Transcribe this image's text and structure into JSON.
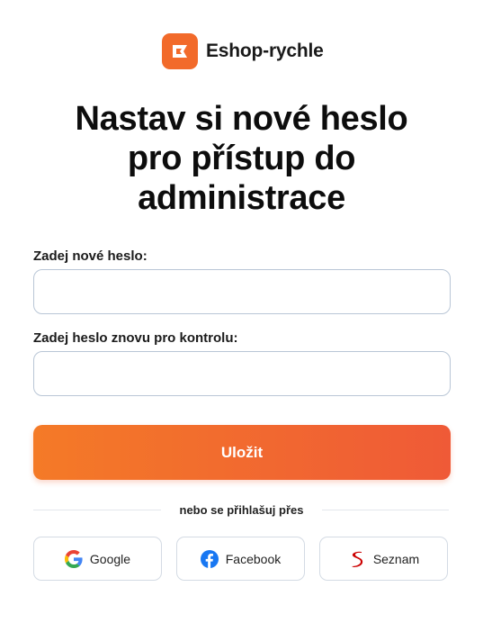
{
  "brand": {
    "name": "Eshop-rychle",
    "icon": "rocket-ticket-icon",
    "color": "#f26a2a"
  },
  "title": {
    "line1": "Nastav si nové heslo",
    "line2": "pro přístup do",
    "line3": "administrace"
  },
  "form": {
    "new_password_label": "Zadej nové heslo:",
    "new_password_value": "",
    "confirm_password_label": "Zadej heslo znovu pro kontrolu:",
    "confirm_password_value": "",
    "submit_label": "Uložit",
    "submit_gradient": [
      "#f47a27",
      "#ef5a37"
    ]
  },
  "social": {
    "divider_text": "nebo se přihlašuj přes",
    "providers": [
      {
        "label": "Google",
        "icon": "google-icon"
      },
      {
        "label": "Facebook",
        "icon": "facebook-icon",
        "color": "#1877f2"
      },
      {
        "label": "Seznam",
        "icon": "seznam-icon",
        "color": "#cc0000"
      }
    ]
  }
}
